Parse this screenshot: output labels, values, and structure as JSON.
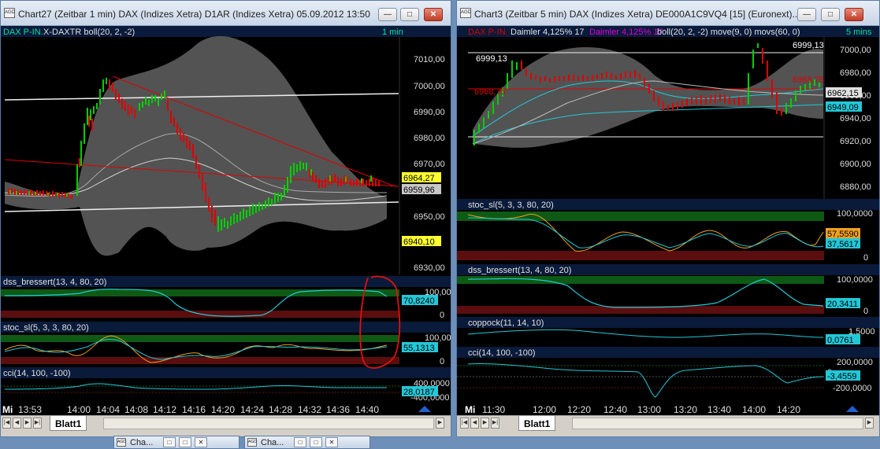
{
  "left_window": {
    "title": "Chart27 (Zeitbar 1 min)  DAX (Indizes Xetra) D1AR (Indizes Xetra) 05.09.2012 13:50 - 0...",
    "icon_text": "AGD",
    "header": {
      "instrument": "DAX P-IN.",
      "rest": "X-DAXTR  boll(20, 2, -2)",
      "interval": "1 min"
    },
    "price_ticks": [
      "7010,00",
      "7000,00",
      "6990,00",
      "6980,00",
      "6970,00",
      "6950,00",
      "6930,00"
    ],
    "badges": [
      "6964,27",
      "6959,96",
      "6940,10"
    ],
    "dss": {
      "label": "dss_bressert(13, 4, 80, 20)",
      "value": "70,8240",
      "top": "100,0000",
      "bottom": "0"
    },
    "stoc": {
      "label": "stoc_sl(5, 3, 3, 80, 20)",
      "value": "55,1313",
      "top": "100,0000",
      "bottom": "0"
    },
    "cci": {
      "label": "cci(14, 100, -100)",
      "value": "28,0187",
      "top": "400,0000",
      "bottom": "-400,0000"
    },
    "time_axis": [
      "Mi",
      "13:53",
      "14:00",
      "14:04",
      "14:08",
      "14:12",
      "14:16",
      "14:20",
      "14:24",
      "14:28",
      "14:32",
      "14:36",
      "14:40"
    ],
    "sheet_tab": "Blatt1"
  },
  "right_window": {
    "title": "Chart3 (Zeitbar 5 min)  DAX (Indizes Xetra) DE000A1C9VQ4 [15] (Euronext)...",
    "icon_text": "AGD",
    "header": {
      "instrument": "DAX P-IN.",
      "daimler": "Daimler  4,125% 17",
      "daimler2": "Daimler  4,125% 17",
      "rest": "boll(20, 2, -2)  move(9, 0)  movs(60, 0)",
      "interval": "5 mins"
    },
    "price_ticks": [
      "7000,00",
      "6980,00",
      "6960,00",
      "6940,00",
      "6920,00",
      "6900,00",
      "6880,00"
    ],
    "line_labels": [
      "6999,13",
      "6999,13",
      "6968,75",
      "6968,75"
    ],
    "badges": [
      "6962,15",
      "6949,09"
    ],
    "stoc": {
      "label": "stoc_sl(5, 3, 3, 80, 20)",
      "values": [
        "57,5590",
        "37,5617"
      ],
      "top": "100,0000",
      "bottom": "0"
    },
    "dss": {
      "label": "dss_bressert(13, 4, 80, 20)",
      "value": "20,3411",
      "top": "100,0000",
      "bottom": "0"
    },
    "coppock": {
      "label": "coppock(11, 14, 10)",
      "value": "0,0761",
      "top": "1,5000"
    },
    "cci": {
      "label": "cci(14, 100, -100)",
      "value": "-3,4559",
      "top": "200,0000",
      "mid": "0",
      "bottom": "-200,0000"
    },
    "time_axis": [
      "Mi",
      "11:30",
      "12:00",
      "12:20",
      "12:40",
      "13:00",
      "13:20",
      "13:40",
      "14:00",
      "14:20"
    ],
    "sheet_tab": "Blatt1"
  },
  "taskbar": [
    {
      "label": "Cha..."
    },
    {
      "label": "Cha..."
    }
  ],
  "colors": {
    "bull": "#00d000",
    "bear": "#e00000",
    "band": "#6a6a6a",
    "cyan": "#22c8d8",
    "orange": "#f0a020",
    "yellow": "#ffff30"
  }
}
